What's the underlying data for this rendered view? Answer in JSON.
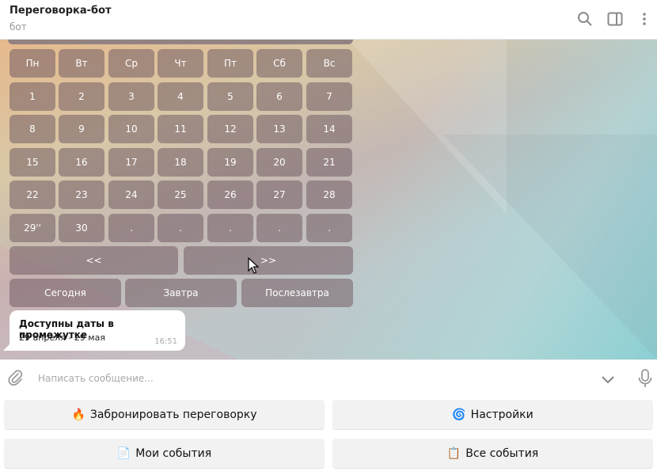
{
  "header": {
    "title": "Переговорка-бот",
    "subtitle": "бот",
    "icons": [
      "search-icon",
      "sidebar-toggle-icon",
      "more-vertical-icon"
    ]
  },
  "calendar": {
    "weekdays": [
      "Пн",
      "Вт",
      "Ср",
      "Чт",
      "Пт",
      "Сб",
      "Вс"
    ],
    "weeks": [
      [
        "1",
        "2",
        "3",
        "4",
        "5",
        "6",
        "7"
      ],
      [
        "8",
        "9",
        "10",
        "11",
        "12",
        "13",
        "14"
      ],
      [
        "15",
        "16",
        "17",
        "18",
        "19",
        "20",
        "21"
      ],
      [
        "22",
        "23",
        "24",
        "25",
        "26",
        "27",
        "28"
      ],
      [
        "29''",
        "30",
        ".",
        ".",
        ".",
        ".",
        "."
      ]
    ],
    "nav": {
      "prev": "<<",
      "next": ">>"
    },
    "quick": [
      "Сегодня",
      "Завтра",
      "Послезавтра"
    ]
  },
  "message": {
    "title": "Доступны даты в промежутке",
    "range": "29 апреля - 29 мая",
    "time": "16:51"
  },
  "composer": {
    "placeholder": "Написать сообщение...",
    "icons": [
      "paperclip-icon",
      "chevron-down-icon",
      "microphone-icon"
    ]
  },
  "reply_keyboard": {
    "buttons": [
      {
        "emoji": "🔥",
        "label": "Забронировать переговорку"
      },
      {
        "emoji": "🌀",
        "label": "Настройки"
      },
      {
        "emoji": "📄",
        "label": "Мои события"
      },
      {
        "emoji": "📋",
        "label": "Все события"
      }
    ]
  },
  "colors": {
    "keyboard_button": "#735c64",
    "bubble": "#ffffff",
    "reply_button": "#f2f2f2"
  }
}
